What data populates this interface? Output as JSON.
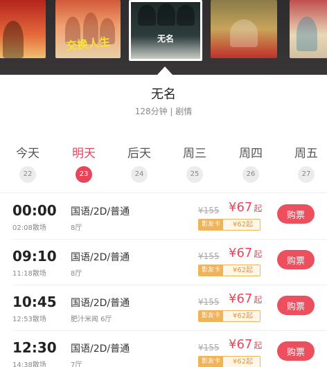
{
  "film": {
    "title": "无名",
    "meta": "128分钟 | 剧情",
    "posters": [
      {
        "name": "poster-1",
        "text": ""
      },
      {
        "name": "poster-2",
        "text": "交换人生"
      },
      {
        "name": "poster-3-selected",
        "text": "无名"
      },
      {
        "name": "poster-4",
        "text": ""
      },
      {
        "name": "poster-5",
        "text": ""
      }
    ]
  },
  "dates": [
    {
      "weekday": "今天",
      "day": "22",
      "active": false
    },
    {
      "weekday": "明天",
      "day": "23",
      "active": true
    },
    {
      "weekday": "后天",
      "day": "24",
      "active": false
    },
    {
      "weekday": "周三",
      "day": "25",
      "active": false
    },
    {
      "weekday": "周四",
      "day": "26",
      "active": false
    },
    {
      "weekday": "周五",
      "day": "27",
      "active": false
    }
  ],
  "showtimes": [
    {
      "time": "00:00",
      "end": "02:08散场",
      "lang": "国语/2D/普通",
      "hall": "8厅",
      "orig": "¥155",
      "price": "¥67",
      "qi": "起",
      "card_label": "影友卡",
      "card_price": "¥62起",
      "buy": "购票"
    },
    {
      "time": "09:10",
      "end": "11:18散场",
      "lang": "国语/2D/普通",
      "hall": "8厅",
      "orig": "¥155",
      "price": "¥67",
      "qi": "起",
      "card_label": "影友卡",
      "card_price": "¥62起",
      "buy": "购票"
    },
    {
      "time": "10:45",
      "end": "12:53散场",
      "lang": "国语/2D/普通",
      "hall": "肥汁米闻 6厅",
      "orig": "¥155",
      "price": "¥67",
      "qi": "起",
      "card_label": "影友卡",
      "card_price": "¥62起",
      "buy": "购票"
    },
    {
      "time": "12:30",
      "end": "14:38散场",
      "lang": "国语/2D/普通",
      "hall": "7厅",
      "orig": "¥155",
      "price": "¥67",
      "qi": "起",
      "card_label": "影友卡",
      "card_price": "¥62起",
      "buy": "购票"
    }
  ],
  "colors": {
    "accent": "#e8455a",
    "card": "#f0b35a"
  }
}
